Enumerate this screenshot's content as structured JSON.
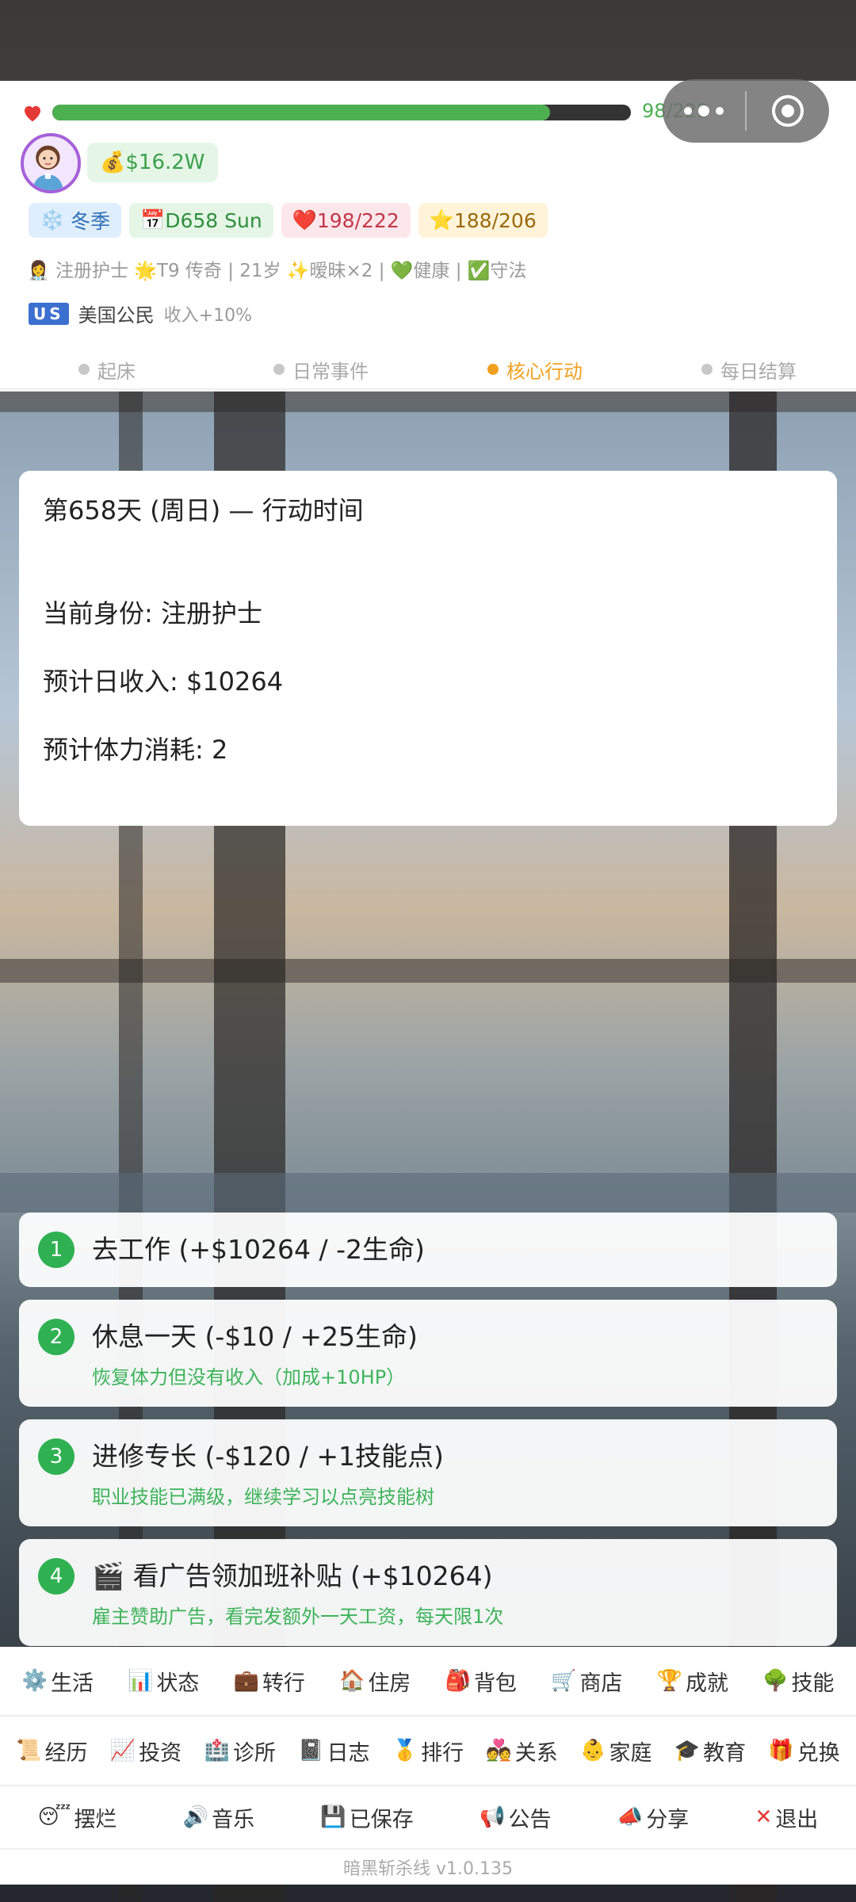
{
  "status": {
    "hp_text": "98/222",
    "hp_fraction": 0.86,
    "money": "$16.2W",
    "chips": {
      "season": "冬季",
      "day": "D658 Sun",
      "hp": "198/222",
      "stamina": "188/206"
    },
    "info_line": "👩‍⚕️ 注册护士 🌟T9 传奇 | 21岁 ✨暧昧×2 | 💚健康 | ✅守法",
    "citizen": {
      "flag": "US",
      "text": "美国公民",
      "bonus": "收入+10%"
    }
  },
  "phases": [
    {
      "label": "起床",
      "active": false
    },
    {
      "label": "日常事件",
      "active": false
    },
    {
      "label": "核心行动",
      "active": true
    },
    {
      "label": "每日结算",
      "active": false
    }
  ],
  "story": {
    "title": "第658天 (周日) — 行动时间",
    "identity": "当前身份: 注册护士",
    "income": "预计日收入: $10264",
    "stamina": "预计体力消耗: 2"
  },
  "choices": [
    {
      "num": "1",
      "title": "去工作 (+$10264 / -2生命)",
      "sub": ""
    },
    {
      "num": "2",
      "title": "休息一天 (-$10 / +25生命)",
      "sub": "恢复体力但没有收入（加成+10HP）"
    },
    {
      "num": "3",
      "title": "进修专长 (-$120 / +1技能点)",
      "sub": "职业技能已满级，继续学习以点亮技能树"
    },
    {
      "num": "4",
      "title": "🎬 看广告领加班补贴 (+$10264)",
      "sub": "雇主赞助广告，看完发额外一天工资，每天限1次"
    }
  ],
  "nav_row1": [
    {
      "icon": "⚙️",
      "label": "生活",
      "name": "nav-life"
    },
    {
      "icon": "📊",
      "label": "状态",
      "name": "nav-status"
    },
    {
      "icon": "💼",
      "label": "转行",
      "name": "nav-career-change"
    },
    {
      "icon": "🏠",
      "label": "住房",
      "name": "nav-housing"
    },
    {
      "icon": "🎒",
      "label": "背包",
      "name": "nav-backpack"
    },
    {
      "icon": "🛒",
      "label": "商店",
      "name": "nav-shop"
    },
    {
      "icon": "🏆",
      "label": "成就",
      "name": "nav-achievements"
    },
    {
      "icon": "🌳",
      "label": "技能",
      "name": "nav-skills"
    }
  ],
  "nav_row2": [
    {
      "icon": "📜",
      "label": "经历",
      "name": "nav-history"
    },
    {
      "icon": "📈",
      "label": "投资",
      "name": "nav-invest"
    },
    {
      "icon": "🏥",
      "label": "诊所",
      "name": "nav-clinic"
    },
    {
      "icon": "📓",
      "label": "日志",
      "name": "nav-log"
    },
    {
      "icon": "🥇",
      "label": "排行",
      "name": "nav-ranking"
    },
    {
      "icon": "💑",
      "label": "关系",
      "name": "nav-relations"
    },
    {
      "icon": "👶",
      "label": "家庭",
      "name": "nav-family"
    },
    {
      "icon": "🎓",
      "label": "教育",
      "name": "nav-education"
    },
    {
      "icon": "🎁",
      "label": "兑换",
      "name": "nav-redeem"
    }
  ],
  "nav_row3": [
    {
      "icon": "😴",
      "label": "摆烂",
      "name": "nav-slack"
    },
    {
      "icon": "🔊",
      "label": "音乐",
      "name": "nav-music"
    },
    {
      "icon": "💾",
      "label": "已保存",
      "name": "nav-saved"
    },
    {
      "icon": "📢",
      "label": "公告",
      "name": "nav-notice"
    },
    {
      "icon": "📣",
      "label": "分享",
      "name": "nav-share"
    },
    {
      "icon": "✕",
      "label": "退出",
      "name": "nav-exit"
    }
  ],
  "version": "暗黑斩杀线 v1.0.135"
}
